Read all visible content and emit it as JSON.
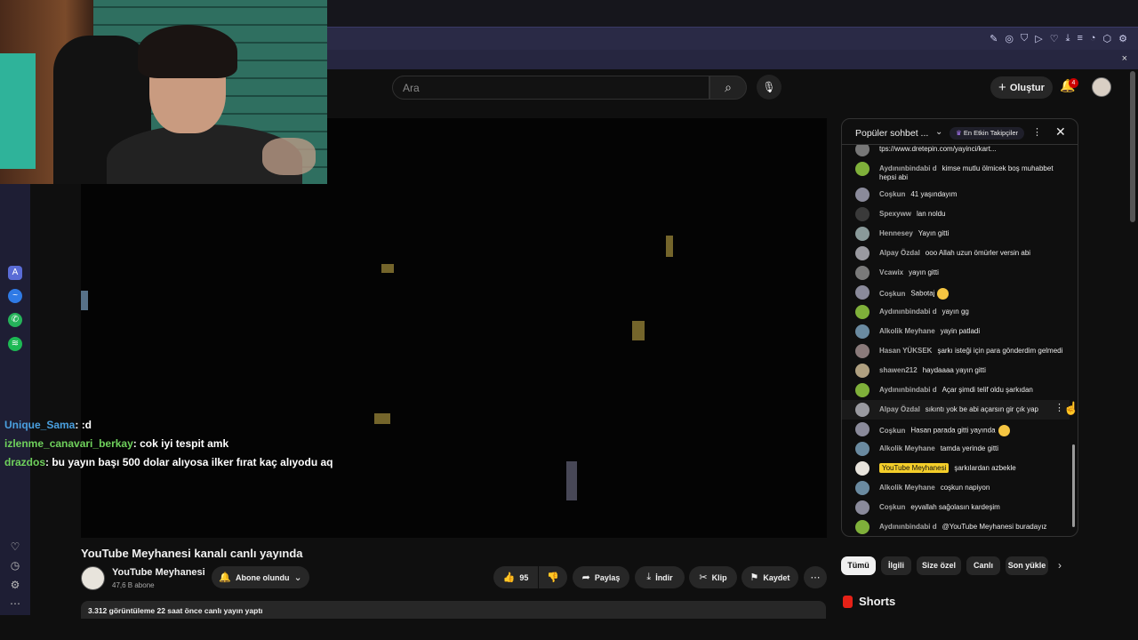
{
  "header": {
    "search_placeholder": "Ara",
    "create_label": "Oluştur",
    "notification_count": "4"
  },
  "browser_sidebar": {
    "apps": [
      "aria-icon",
      "messenger-icon",
      "whatsapp-icon",
      "spotify-icon"
    ],
    "bottom_icons": [
      "heart-icon",
      "history-icon",
      "settings-icon",
      "more-icon"
    ]
  },
  "overlay_chat": [
    {
      "user": "Unique_Sama",
      "message": ": :d"
    },
    {
      "user": "izlenme_canavari_berkay",
      "message": ": cok iyi tespit amk"
    },
    {
      "user": "drazdos",
      "message": ": bu yayın başı 500 dolar alıyosa ilker fırat kaç alıyodu aq"
    }
  ],
  "video": {
    "title": "YouTube Meyhanesi kanalı canlı yayında",
    "channel_name": "YouTube Meyhanesi",
    "subscribers": "47,6 B abone",
    "subscribe_label": "Abone olundu",
    "like_count": "95",
    "share_label": "Paylaş",
    "download_label": "İndir",
    "clip_label": "Klip",
    "save_label": "Kaydet",
    "description_meta": "3.312 görüntüleme  22 saat önce canlı yayın yaptı"
  },
  "chat": {
    "title": "Popüler sohbet ...",
    "top_fans_label": "En Etkin Takipçiler",
    "messages": [
      {
        "author": "",
        "text": "tps://www.dretepin.com/yayinci/kart...",
        "color": "#777"
      },
      {
        "author": "Aydınınbindabi d",
        "text": "kimse mutlu ölmicek boş muhabbet hepsi abi",
        "color": "#7fb03a"
      },
      {
        "author": "Coşkun",
        "text": "41 yaşındayım",
        "color": "#8a8a9a"
      },
      {
        "author": "Spexyww",
        "text": "lan noldu",
        "color": "#3a3a3a"
      },
      {
        "author": "Hennesey",
        "text": "Yayın gitti",
        "color": "#8a9a9a"
      },
      {
        "author": "Alpay Özdal",
        "text": "ooo Allah uzun ömürler versin abi",
        "color": "#9a9aa0"
      },
      {
        "author": "Vcawix",
        "text": "yayın gitti",
        "color": "#7a7a7a"
      },
      {
        "author": "Coşkun",
        "text": "Sabotaj",
        "color": "#8a8a9a",
        "emoji": true
      },
      {
        "author": "Aydınınbindabi d",
        "text": "yayın gg",
        "color": "#7fb03a"
      },
      {
        "author": "Alkolik Meyhane",
        "text": "yayin patladi",
        "color": "#6a8aa0"
      },
      {
        "author": "Hasan YÜKSEK",
        "text": "şarkı isteği için para gönderdim gelmedi",
        "color": "#8a7a7a"
      },
      {
        "author": "shawen212",
        "text": "haydaaaa yayın gitti",
        "color": "#b0a080"
      },
      {
        "author": "Aydınınbindabi d",
        "text": "Açar şimdi telif oldu şarkıdan",
        "color": "#7fb03a"
      },
      {
        "author": "Alpay Özdal",
        "text": "sıkıntı yok be abi açarsın gir çık yap",
        "color": "#9a9aa0",
        "highlight": true
      },
      {
        "author": "Coşkun",
        "text": "Hasan parada gitti yayında",
        "color": "#8a8a9a",
        "emoji": true
      },
      {
        "author": "Alkolik Meyhane",
        "text": "tamda yerinde gitti",
        "color": "#6a8aa0"
      },
      {
        "author": "YouTube Meyhanesi",
        "text": "şarkılardan azbekle",
        "color": "#e8e4dc",
        "owner": true
      },
      {
        "author": "Alkolik Meyhane",
        "text": "coşkun napiyon",
        "color": "#6a8aa0"
      },
      {
        "author": "Coşkun",
        "text": "eyvallah sağolasın kardeşim",
        "color": "#8a8a9a"
      },
      {
        "author": "Aydınınbindabi d",
        "text": "@YouTube Meyhanesi buradayız",
        "color": "#7fb03a"
      }
    ]
  },
  "chips": [
    "Tümü",
    "İlgili",
    "Size özel",
    "Canlı",
    "Son yükle"
  ],
  "shorts_label": "Shorts"
}
